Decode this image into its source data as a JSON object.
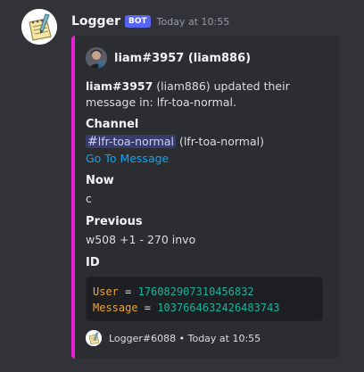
{
  "message": {
    "username": "Logger",
    "bot_tag": "BOT",
    "timestamp": "Today at 10:55"
  },
  "embed": {
    "accent_color": "#e91fd3",
    "author_name": "liam#3957 (liam886)",
    "description": {
      "bold_user": "liam#3957",
      "text": " (liam886) updated their message in: lfr-toa-normal."
    },
    "fields": {
      "channel_name": "Channel",
      "channel_mention": "lfr-toa-normal",
      "channel_suffix": " (lfr-toa-normal)",
      "go_to_message": "Go To Message",
      "now_name": "Now",
      "now_value": "c",
      "previous_name": "Previous",
      "previous_value": "w508 +1 - 270 invo",
      "id_name": "ID"
    },
    "code": {
      "user_key": "User",
      "eq": " = ",
      "user_value": "176082907310456832",
      "message_key": "Message",
      "message_value": "1037664632426483743"
    },
    "footer": {
      "text": "Logger#6088 • Today at 10:55"
    }
  },
  "icons": {
    "bot_avatar": "notepad-pencil-icon",
    "author_avatar": "user-photo-avatar",
    "channel_hash": "hash-icon",
    "footer_avatar": "notepad-pencil-icon"
  }
}
